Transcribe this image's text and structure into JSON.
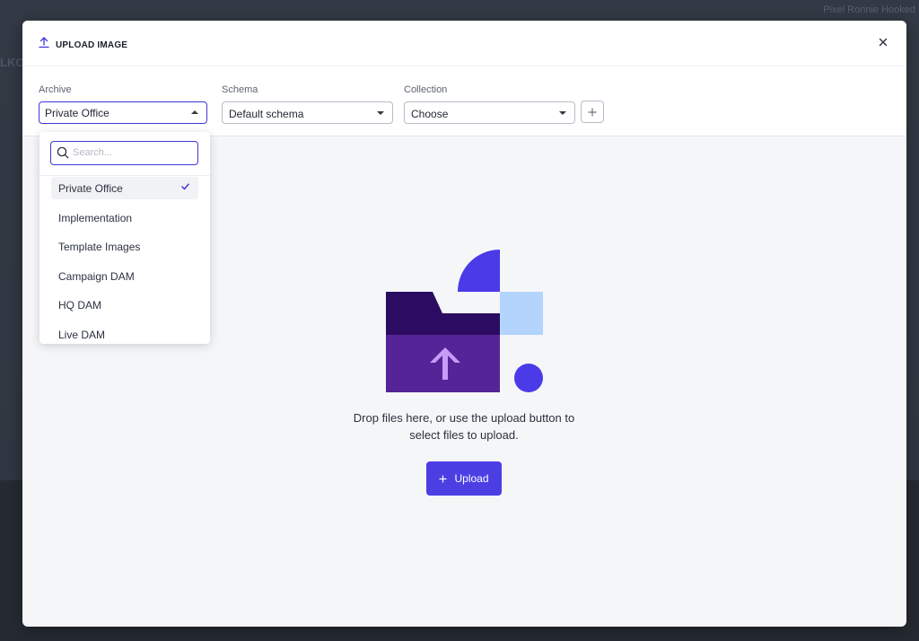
{
  "backdrop": {
    "top_right_text": "Pixel Ronnie Hooked",
    "left_text": "LKO"
  },
  "modal": {
    "title": "UPLOAD IMAGE"
  },
  "fields": {
    "archive": {
      "label": "Archive",
      "value": "Private Office"
    },
    "schema": {
      "label": "Schema",
      "value": "Default schema"
    },
    "collection": {
      "label": "Collection",
      "value": "Choose"
    }
  },
  "dropdown": {
    "search_placeholder": "Search...",
    "items": [
      {
        "label": "Private Office",
        "selected": true
      },
      {
        "label": "Implementation"
      },
      {
        "label": "Template Images"
      },
      {
        "label": "Campaign DAM"
      },
      {
        "label": "HQ DAM"
      },
      {
        "label": "Live DAM"
      }
    ]
  },
  "dropzone": {
    "line1": "Drop files here, or use the upload button to",
    "line2": "select files to upload.",
    "upload_label": "Upload"
  },
  "colors": {
    "accent": "#4b3fe4",
    "folder_dark": "#2c0c62",
    "folder_body": "#552496",
    "arrow": "#c59cf7",
    "light_blue": "#b3d4fc",
    "circle": "#4a3ae8"
  },
  "icons": [
    "upload-icon",
    "close-icon",
    "plus-icon",
    "search-icon",
    "check-icon",
    "chevron-down-icon"
  ]
}
